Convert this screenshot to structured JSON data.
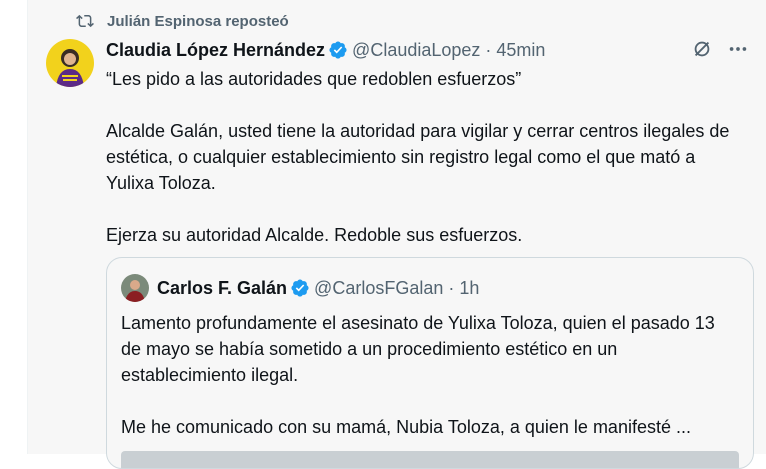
{
  "repost": {
    "label": "Julián Espinosa reposteó",
    "icon": "repost-icon"
  },
  "tweet": {
    "author_name": "Claudia López Hernández",
    "handle": "@ClaudiaLopez",
    "separator": "·",
    "time": "45min",
    "body": [
      "“Les pido a las autoridades que redoblen esfuerzos”",
      "",
      "Alcalde Galán, usted tiene la autoridad para vigilar y cerrar centros ilegales de estética, o cualquier establecimiento sin registro legal como el que mató a Yulixa Toloza.",
      "",
      "Ejerza su autoridad Alcalde. Redoble sus esfuerzos."
    ],
    "verified_color": "#1d9bf0",
    "avatar_colors": {
      "background": "#f2d21c",
      "accent": "#5b2a86"
    }
  },
  "quote": {
    "author_name": "Carlos F. Galán",
    "handle": "@CarlosFGalan",
    "separator": "·",
    "time": "1h",
    "body": [
      "Lamento profundamente el asesinato de Yulixa Toloza, quien el pasado 13 de mayo se había sometido a un procedimiento estético en un establecimiento ilegal.",
      "",
      "Me he comunicado con su mamá, Nubia Toloza, a quien le manifesté ..."
    ]
  }
}
